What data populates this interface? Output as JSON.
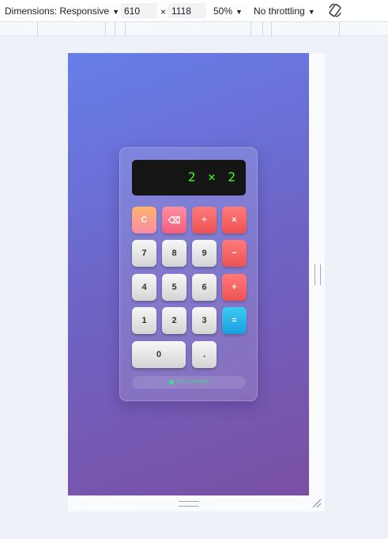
{
  "toolbar": {
    "dimensions_label": "Dimensions: Responsive",
    "width_value": "610",
    "times": "×",
    "height_value": "1118",
    "zoom_label": "50%",
    "throttle_label": "No throttling",
    "dropdown_arrow": "▼"
  },
  "calculator": {
    "display": "2 × 2",
    "buttons": {
      "clear": "C",
      "backspace": "⌫",
      "divide": "÷",
      "multiply": "×",
      "seven": "7",
      "eight": "8",
      "nine": "9",
      "minus": "−",
      "four": "4",
      "five": "5",
      "six": "6",
      "plus": "+",
      "one": "1",
      "two": "2",
      "three": "3",
      "equals": "=",
      "zero": "0",
      "decimal": "."
    },
    "api_status": "API Connected"
  },
  "colors": {
    "gradient_start": "#667eea",
    "gradient_end": "#7a4fa3",
    "display_text": "#39ff14",
    "operator": "#ee5253",
    "equals": "#1a9fe0"
  }
}
